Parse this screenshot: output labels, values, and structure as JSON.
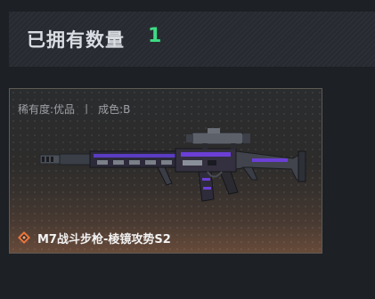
{
  "header": {
    "owned_label": "已拥有数量",
    "owned_count": "1"
  },
  "item": {
    "rarity_label": "稀有度:",
    "rarity_value": "优品",
    "separator": "丨",
    "wear_label": "成色:",
    "wear_value": "B",
    "name": "M7战斗步枪-棱镜攻势S2",
    "quality_icon": "diamond-quality-icon"
  },
  "colors": {
    "count_green": "#3ddc84",
    "header_text": "#d9dde2",
    "meta_text": "#9da0a5",
    "quality_orange": "#e8743b",
    "weapon_accent_purple": "#6b3fd6"
  }
}
